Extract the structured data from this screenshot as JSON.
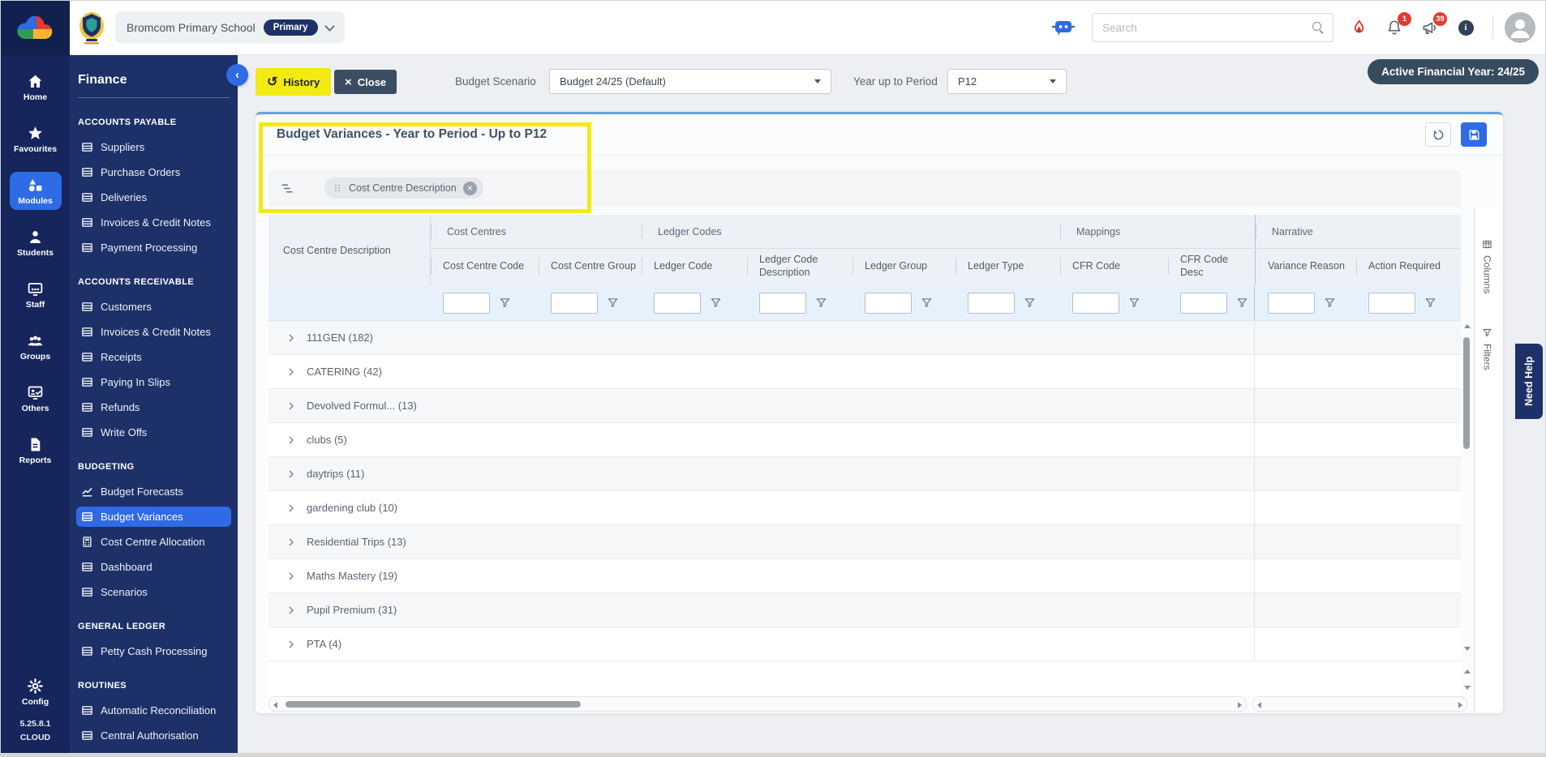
{
  "colors": {
    "accent_blue": "#2e6be5",
    "rail_navy": "#16255b",
    "panel_navy": "#1d3168",
    "highlight_yellow": "#f3e913",
    "slate_button": "#3a4d62",
    "badge_red": "#e23c2e",
    "card_top_border": "#69a2dd"
  },
  "topbar": {
    "school_name": "Bromcom Primary School",
    "school_phase": "Primary",
    "search_placeholder": "Search",
    "notification_count": "1",
    "announcement_count": "39"
  },
  "rail": {
    "items": [
      {
        "label": "Home",
        "icon": "home"
      },
      {
        "label": "Favourites",
        "icon": "star"
      },
      {
        "label": "Modules",
        "icon": "modules",
        "active": true
      },
      {
        "label": "Students",
        "icon": "student"
      },
      {
        "label": "Staff",
        "icon": "staff"
      },
      {
        "label": "Groups",
        "icon": "groups"
      },
      {
        "label": "Others",
        "icon": "others"
      },
      {
        "label": "Reports",
        "icon": "report"
      }
    ],
    "config_label": "Config",
    "version": "5.25.8.1",
    "edition": "CLOUD"
  },
  "sidebar": {
    "title": "Finance",
    "sections": [
      {
        "heading": "ACCOUNTS PAYABLE",
        "items": [
          {
            "label": "Suppliers",
            "icon": "rows"
          },
          {
            "label": "Purchase Orders",
            "icon": "rows"
          },
          {
            "label": "Deliveries",
            "icon": "rows"
          },
          {
            "label": "Invoices & Credit Notes",
            "icon": "rows"
          },
          {
            "label": "Payment Processing",
            "icon": "rows"
          }
        ]
      },
      {
        "heading": "ACCOUNTS RECEIVABLE",
        "items": [
          {
            "label": "Customers",
            "icon": "rows"
          },
          {
            "label": "Invoices & Credit Notes",
            "icon": "rows"
          },
          {
            "label": "Receipts",
            "icon": "rows"
          },
          {
            "label": "Paying In Slips",
            "icon": "rows"
          },
          {
            "label": "Refunds",
            "icon": "rows"
          },
          {
            "label": "Write Offs",
            "icon": "rows"
          }
        ]
      },
      {
        "heading": "BUDGETING",
        "items": [
          {
            "label": "Budget Forecasts",
            "icon": "chart"
          },
          {
            "label": "Budget Variances",
            "icon": "rows",
            "active": true
          },
          {
            "label": "Cost Centre Allocation",
            "icon": "calc"
          },
          {
            "label": "Dashboard",
            "icon": "rows"
          },
          {
            "label": "Scenarios",
            "icon": "rows"
          }
        ]
      },
      {
        "heading": "GENERAL LEDGER",
        "items": [
          {
            "label": "Petty Cash Processing",
            "icon": "rows"
          }
        ]
      },
      {
        "heading": "ROUTINES",
        "items": [
          {
            "label": "Automatic Reconciliation",
            "icon": "rows"
          },
          {
            "label": "Central Authorisation",
            "icon": "rows"
          }
        ]
      }
    ]
  },
  "toolbar": {
    "history_label": "History",
    "close_label": "Close",
    "budget_scenario_label": "Budget Scenario",
    "budget_scenario_value": "Budget 24/25 (Default)",
    "period_label": "Year up to Period",
    "period_value": "P12",
    "active_year_badge": "Active Financial Year: 24/25"
  },
  "panel": {
    "title": "Budget Variances - Year to Period - Up to P12",
    "group_chip": "Cost Centre Description"
  },
  "table": {
    "pinned_header": "Cost Centre Description",
    "groups": [
      {
        "label": "Cost Centres",
        "cols": [
          "Cost Centre Code",
          "Cost Centre Group"
        ]
      },
      {
        "label": "Ledger Codes",
        "cols": [
          "Ledger Code",
          "Ledger Code Description",
          "Ledger Group",
          "Ledger Type"
        ]
      },
      {
        "label": "Mappings",
        "cols": [
          "CFR Code",
          "CFR Code Desc"
        ]
      },
      {
        "label": "Narrative",
        "cols": [
          "Variance Reason",
          "Action Required"
        ]
      }
    ],
    "rows": [
      "111GEN (182)",
      "CATERING (42)",
      "Devolved Formul... (13)",
      "clubs (5)",
      "daytrips (11)",
      "gardening club (10)",
      "Residential Trips (13)",
      "Maths Mastery (19)",
      "Pupil Premium (31)",
      "PTA (4)"
    ]
  },
  "side_tabs": {
    "columns": "Columns",
    "filters": "Filters"
  },
  "help_tab": "Need Help"
}
